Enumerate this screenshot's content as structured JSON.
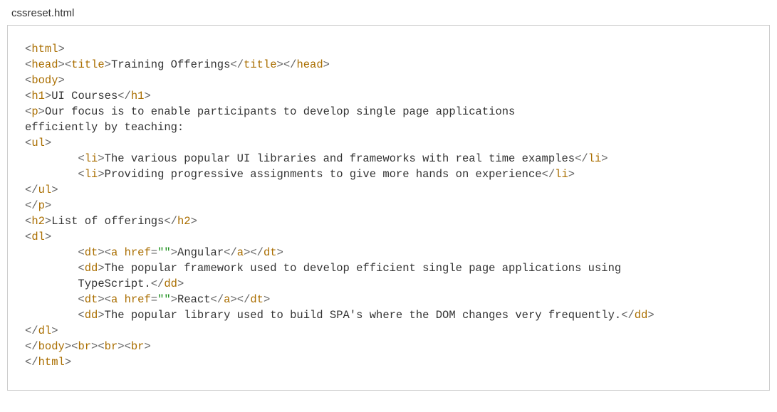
{
  "filename": "cssreset.html",
  "code": {
    "line1": {
      "tag_html": "html"
    },
    "line2": {
      "tag_head": "head",
      "tag_title": "title",
      "title_text": "Training Offerings"
    },
    "line3": {
      "tag_body": "body"
    },
    "line4": {
      "tag_h1": "h1",
      "h1_text": "UI Courses"
    },
    "line5": {
      "tag_p": "p",
      "p_text": "Our focus is to enable participants to develop single page applications"
    },
    "line6": {
      "p_text2": "efficiently by teaching:"
    },
    "line7": {
      "tag_ul": "ul"
    },
    "line8": {
      "tag_li": "li",
      "li1_text": "The various popular UI libraries and frameworks with real time examples"
    },
    "line9": {
      "tag_li": "li",
      "li2_text": "Providing progressive assignments to give more hands on experience"
    },
    "line10": {
      "tag_ul": "ul"
    },
    "line11": {
      "tag_p": "p"
    },
    "line12": {
      "tag_h2": "h2",
      "h2_text": "List of offerings"
    },
    "line13": {
      "tag_dl": "dl"
    },
    "line14": {
      "tag_dt": "dt",
      "tag_a": "a",
      "attr_href": "href",
      "href_val": "\"\"",
      "a1_text": "Angular"
    },
    "line15": {
      "tag_dd": "dd",
      "dd1_text": "The popular framework used to develop efficient single page applications using"
    },
    "line16": {
      "dd1_text2": "TypeScript."
    },
    "line17": {
      "tag_dt": "dt",
      "tag_a": "a",
      "attr_href": "href",
      "href_val": "\"\"",
      "a2_text": "React"
    },
    "line18": {
      "tag_dd": "dd",
      "dd2_text": "The popular library used to build SPA's where the DOM changes very frequently."
    },
    "line19": {
      "tag_dl": "dl"
    },
    "line20": {
      "tag_body": "body",
      "tag_br": "br"
    },
    "line21": {
      "tag_html": "html"
    }
  }
}
